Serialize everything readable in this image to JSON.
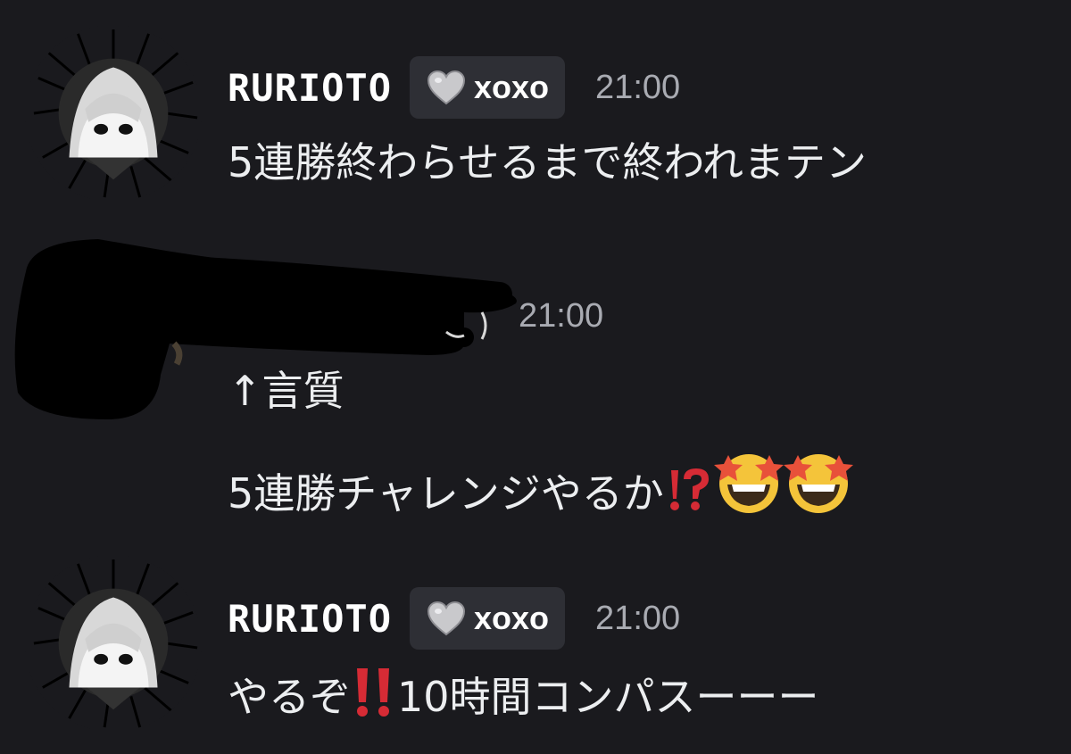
{
  "messages": [
    {
      "author": "RURIOTO",
      "tag": "xoxo",
      "time": "21:00",
      "lines": [
        "5連勝終わらせるまで終われまテン"
      ]
    },
    {
      "author": "",
      "author_redacted": true,
      "time": "21:00",
      "lines": [
        "↑言質",
        "5連勝チャレンジやるか"
      ]
    },
    {
      "author": "RURIOTO",
      "tag": "xoxo",
      "time": "21:00",
      "line_start": "やるぞ",
      "line_end": "10時間コンパスーーー"
    }
  ],
  "icons": {
    "tag_icon": "gray-heart-icon",
    "interrobang": "interrobang-emoji-icon",
    "double_exclamation": "double-exclamation-emoji-icon",
    "star_struck": "star-struck-emoji-icon"
  },
  "colors": {
    "background": "#1a1a1e",
    "tag_bg": "#2e2f35",
    "timestamp": "#a9abb2",
    "emoji_red": "#d62b35"
  }
}
